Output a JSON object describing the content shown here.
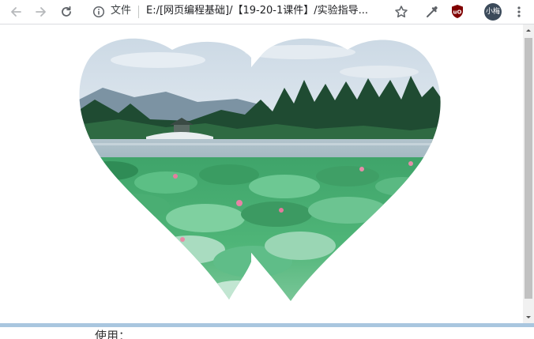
{
  "browser": {
    "scheme_label": "文件",
    "url": "E:/[网页编程基础]/【19-20-1课件】/实验指导...",
    "profile_initials": "小梅",
    "accent_color": "#5f6368",
    "icons": [
      "back-icon",
      "forward-icon",
      "reload-icon",
      "info-icon",
      "star-icon",
      "eyedropper-icon",
      "ublock-icon",
      "menu-icon"
    ]
  },
  "page": {
    "image_content": "heart-shaped lotus-lake photo",
    "bottom_text": "使用："
  }
}
